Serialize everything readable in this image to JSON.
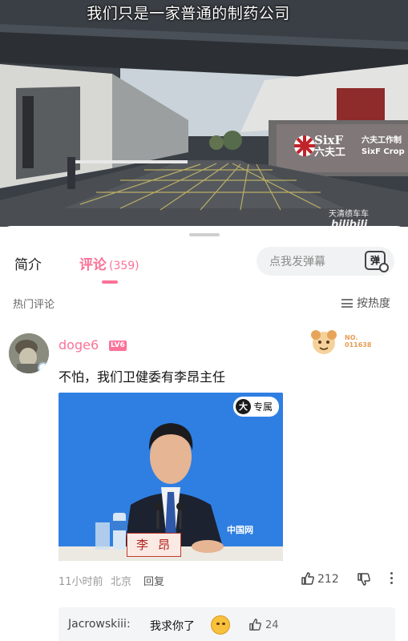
{
  "video": {
    "subtitle": "我们只是一家普通的制药公司",
    "sign_brand_latin": "SixF",
    "sign_brand_cn": "六夫工",
    "sign_company_cn": "六夫工作制",
    "sign_company_en": "SixF Crop Pro",
    "watermark_text": "天清绩车车",
    "watermark_logo": "bilibili"
  },
  "tabs": [
    {
      "label": "简介"
    },
    {
      "label": "评论",
      "count": "(359)"
    }
  ],
  "danmaku": {
    "placeholder": "点我发弹幕",
    "button": "弹"
  },
  "section": {
    "hot_label": "热门评论",
    "sort_label": "按热度"
  },
  "comment": {
    "username": "doge6",
    "level": "LV6",
    "fan_label": "NO.",
    "fan_number": "011638",
    "text": "不怕，我们卫健委有李昂主任",
    "image": {
      "exclusive_big": "大",
      "exclusive_text": "专属",
      "nameplate": "李昂",
      "logo": "中国网"
    },
    "time": "11小时前",
    "location": "北京",
    "reply_label": "回复",
    "likes": "212"
  },
  "reply": {
    "user": "Jacrowskiii:",
    "text": "我求你了",
    "likes": "24"
  },
  "colors": {
    "accent": "#fb7299",
    "text": "#111111",
    "muted": "#9a9a9a"
  }
}
